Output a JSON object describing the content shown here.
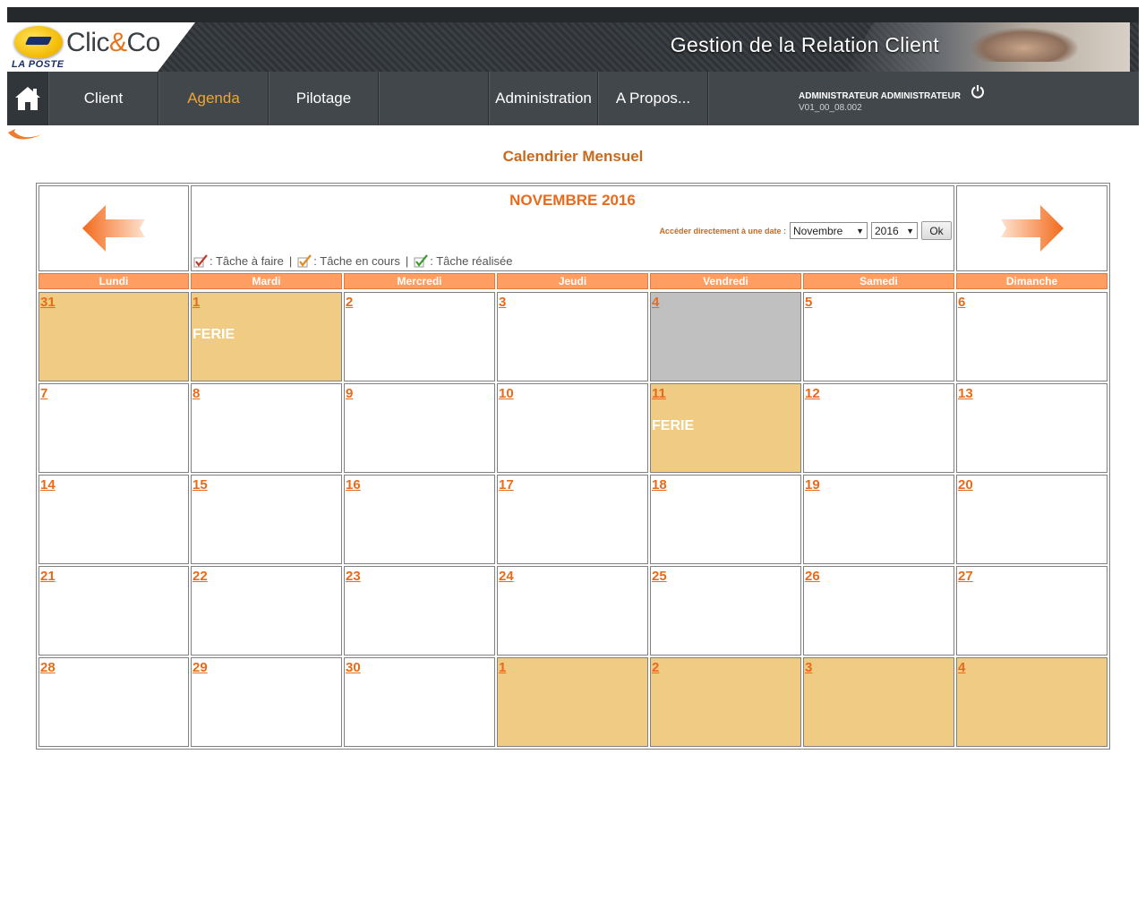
{
  "header": {
    "logo_main": "Clic",
    "logo_amp": "&",
    "logo_end": "Co",
    "logo_sub": "LA POSTE",
    "title": "Gestion de la Relation Client"
  },
  "nav": {
    "items": [
      {
        "label": "Client",
        "active": false
      },
      {
        "label": "Agenda",
        "active": true
      },
      {
        "label": "Pilotage",
        "active": false
      },
      {
        "label": "",
        "active": false
      },
      {
        "label": "Administration",
        "active": false
      },
      {
        "label": "A Propos...",
        "active": false
      }
    ],
    "user": "ADMINISTRATEUR ADMINISTRATEUR",
    "version": "V01_00_08.002"
  },
  "page_title": "Calendrier Mensuel",
  "calendar": {
    "month_title": "NOVEMBRE 2016",
    "goto_label": "Accéder directement à une date :",
    "month_select": "Novembre",
    "year_select": "2016",
    "ok_label": "Ok",
    "legend": {
      "todo": ": Tâche à faire",
      "in_progress": ": Tâche en cours",
      "done": ": Tâche réalisée",
      "separator": "|"
    },
    "weekdays": [
      "Lundi",
      "Mardi",
      "Mercredi",
      "Jeudi",
      "Vendredi",
      "Samedi",
      "Dimanche"
    ],
    "weeks": [
      [
        {
          "day": "31",
          "state": "other"
        },
        {
          "day": "1",
          "state": "holiday",
          "note": "FERIE"
        },
        {
          "day": "2",
          "state": "normal"
        },
        {
          "day": "3",
          "state": "normal"
        },
        {
          "day": "4",
          "state": "today"
        },
        {
          "day": "5",
          "state": "normal"
        },
        {
          "day": "6",
          "state": "normal"
        }
      ],
      [
        {
          "day": "7",
          "state": "normal"
        },
        {
          "day": "8",
          "state": "normal"
        },
        {
          "day": "9",
          "state": "normal"
        },
        {
          "day": "10",
          "state": "normal"
        },
        {
          "day": "11",
          "state": "holiday",
          "note": "FERIE"
        },
        {
          "day": "12",
          "state": "normal"
        },
        {
          "day": "13",
          "state": "normal"
        }
      ],
      [
        {
          "day": "14",
          "state": "normal"
        },
        {
          "day": "15",
          "state": "normal"
        },
        {
          "day": "16",
          "state": "normal"
        },
        {
          "day": "17",
          "state": "normal"
        },
        {
          "day": "18",
          "state": "normal"
        },
        {
          "day": "19",
          "state": "normal"
        },
        {
          "day": "20",
          "state": "normal"
        }
      ],
      [
        {
          "day": "21",
          "state": "normal"
        },
        {
          "day": "22",
          "state": "normal"
        },
        {
          "day": "23",
          "state": "normal"
        },
        {
          "day": "24",
          "state": "normal"
        },
        {
          "day": "25",
          "state": "normal"
        },
        {
          "day": "26",
          "state": "normal"
        },
        {
          "day": "27",
          "state": "normal"
        }
      ],
      [
        {
          "day": "28",
          "state": "normal"
        },
        {
          "day": "29",
          "state": "normal"
        },
        {
          "day": "30",
          "state": "normal"
        },
        {
          "day": "1",
          "state": "other"
        },
        {
          "day": "2",
          "state": "other"
        },
        {
          "day": "3",
          "state": "other"
        },
        {
          "day": "4",
          "state": "other"
        }
      ]
    ]
  },
  "icons": {
    "home": "home-icon",
    "power": "power-icon",
    "prev": "arrow-left-icon",
    "next": "arrow-right-icon",
    "back": "back-swoosh-icon",
    "todo": "check-red-icon",
    "in_progress": "check-orange-icon",
    "done": "check-green-icon"
  },
  "colors": {
    "accent": "#e86a1a",
    "header_orange": "#ff9e63",
    "holiday": "#efcb84",
    "today": "#c0c0c0",
    "nav_active": "#f0a531",
    "nav_bg": "#42474c"
  }
}
